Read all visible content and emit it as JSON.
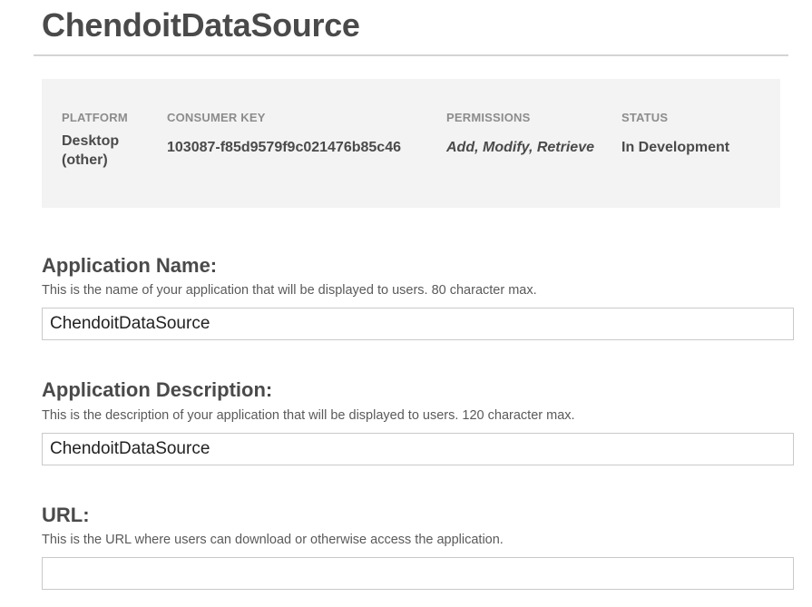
{
  "app": {
    "title": "ChendoitDataSource"
  },
  "info": {
    "platform": {
      "header": "PLATFORM",
      "value": "Desktop (other)"
    },
    "consumer_key": {
      "header": "CONSUMER KEY",
      "value": "103087-f85d9579f9c021476b85c46"
    },
    "permissions": {
      "header": "PERMISSIONS",
      "value": "Add, Modify, Retrieve"
    },
    "status": {
      "header": "STATUS",
      "value": "In Development"
    }
  },
  "fields": {
    "name": {
      "label": "Application Name:",
      "help": "This is the name of your application that will be displayed to users. 80 character max.",
      "value": "ChendoitDataSource"
    },
    "description": {
      "label": "Application Description:",
      "help": "This is the description of your application that will be displayed to users. 120 character max.",
      "value": "ChendoitDataSource"
    },
    "url": {
      "label": "URL:",
      "help": "This is the URL where users can download or otherwise access the application.",
      "value": ""
    }
  }
}
